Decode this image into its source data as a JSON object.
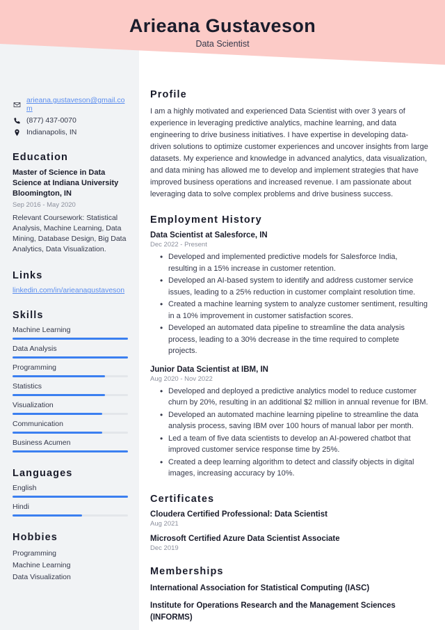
{
  "header": {
    "name": "Arieana Gustaveson",
    "job_title": "Data Scientist",
    "band_color": "#fccbc7"
  },
  "theme": {
    "accent": "#3b7ff0",
    "sidebar_bg": "#f1f3f5",
    "heading_color": "#1a1c2b",
    "link_color": "#5a8dee",
    "muted_color": "#8b8f9c"
  },
  "sidebar": {
    "contact": [
      {
        "icon": "envelope-icon",
        "text": "arieana.gustaveson@gmail.com",
        "is_link": true
      },
      {
        "icon": "phone-icon",
        "text": "(877) 437-0070",
        "is_link": false
      },
      {
        "icon": "location-pin-icon",
        "text": "Indianapolis, IN",
        "is_link": false
      }
    ],
    "education": {
      "title": "Education",
      "degree": "Master of Science in Data Science at Indiana University Bloomington, IN",
      "date": "Sep 2016 - May 2020",
      "description": "Relevant Coursework: Statistical Analysis, Machine Learning, Data Mining, Database Design, Big Data Analytics, Data Visualization."
    },
    "links": {
      "title": "Links",
      "items": [
        {
          "label": "linkedin.com/in/arieanagustaveson"
        }
      ]
    },
    "skills": {
      "title": "Skills",
      "items": [
        {
          "label": "Machine Learning",
          "level": 100
        },
        {
          "label": "Data Analysis",
          "level": 100
        },
        {
          "label": "Programming",
          "level": 80
        },
        {
          "label": "Statistics",
          "level": 80
        },
        {
          "label": "Visualization",
          "level": 78
        },
        {
          "label": "Communication",
          "level": 78
        },
        {
          "label": "Business Acumen",
          "level": 100
        }
      ]
    },
    "languages": {
      "title": "Languages",
      "items": [
        {
          "label": "English",
          "level": 100
        },
        {
          "label": "Hindi",
          "level": 60
        }
      ]
    },
    "hobbies": {
      "title": "Hobbies",
      "items": [
        {
          "label": "Programming"
        },
        {
          "label": "Machine Learning"
        },
        {
          "label": "Data Visualization"
        }
      ]
    }
  },
  "main": {
    "profile": {
      "title": "Profile",
      "text": "I am a highly motivated and experienced Data Scientist with over 3 years of experience in leveraging predictive analytics, machine learning, and data engineering to drive business initiatives. I have expertise in developing data-driven solutions to optimize customer experiences and uncover insights from large datasets. My experience and knowledge in advanced analytics, data visualization, and data mining has allowed me to develop and implement strategies that have improved business operations and increased revenue. I am passionate about leveraging data to solve complex problems and drive business success."
    },
    "employment": {
      "title": "Employment History",
      "jobs": [
        {
          "title": "Data Scientist at Salesforce, IN",
          "date": "Dec 2022 - Present",
          "bullets": [
            "Developed and implemented predictive models for Salesforce India, resulting in a 15% increase in customer retention.",
            "Developed an AI-based system to identify and address customer service issues, leading to a 25% reduction in customer complaint resolution time.",
            "Created a machine learning system to analyze customer sentiment, resulting in a 10% improvement in customer satisfaction scores.",
            "Developed an automated data pipeline to streamline the data analysis process, leading to a 30% decrease in the time required to complete projects."
          ]
        },
        {
          "title": "Junior Data Scientist at IBM, IN",
          "date": "Aug 2020 - Nov 2022",
          "bullets": [
            "Developed and deployed a predictive analytics model to reduce customer churn by 20%, resulting in an additional $2 million in annual revenue for IBM.",
            "Developed an automated machine learning pipeline to streamline the data analysis process, saving IBM over 100 hours of manual labor per month.",
            "Led a team of five data scientists to develop an AI-powered chatbot that improved customer service response time by 25%.",
            "Created a deep learning algorithm to detect and classify objects in digital images, increasing accuracy by 10%."
          ]
        }
      ]
    },
    "certificates": {
      "title": "Certificates",
      "items": [
        {
          "name": "Cloudera Certified Professional: Data Scientist",
          "date": "Aug 2021"
        },
        {
          "name": "Microsoft Certified Azure Data Scientist Associate",
          "date": "Dec 2019"
        }
      ]
    },
    "memberships": {
      "title": "Memberships",
      "items": [
        {
          "name": "International Association for Statistical Computing (IASC)"
        },
        {
          "name": "Institute for Operations Research and the Management Sciences (INFORMS)"
        }
      ]
    }
  }
}
